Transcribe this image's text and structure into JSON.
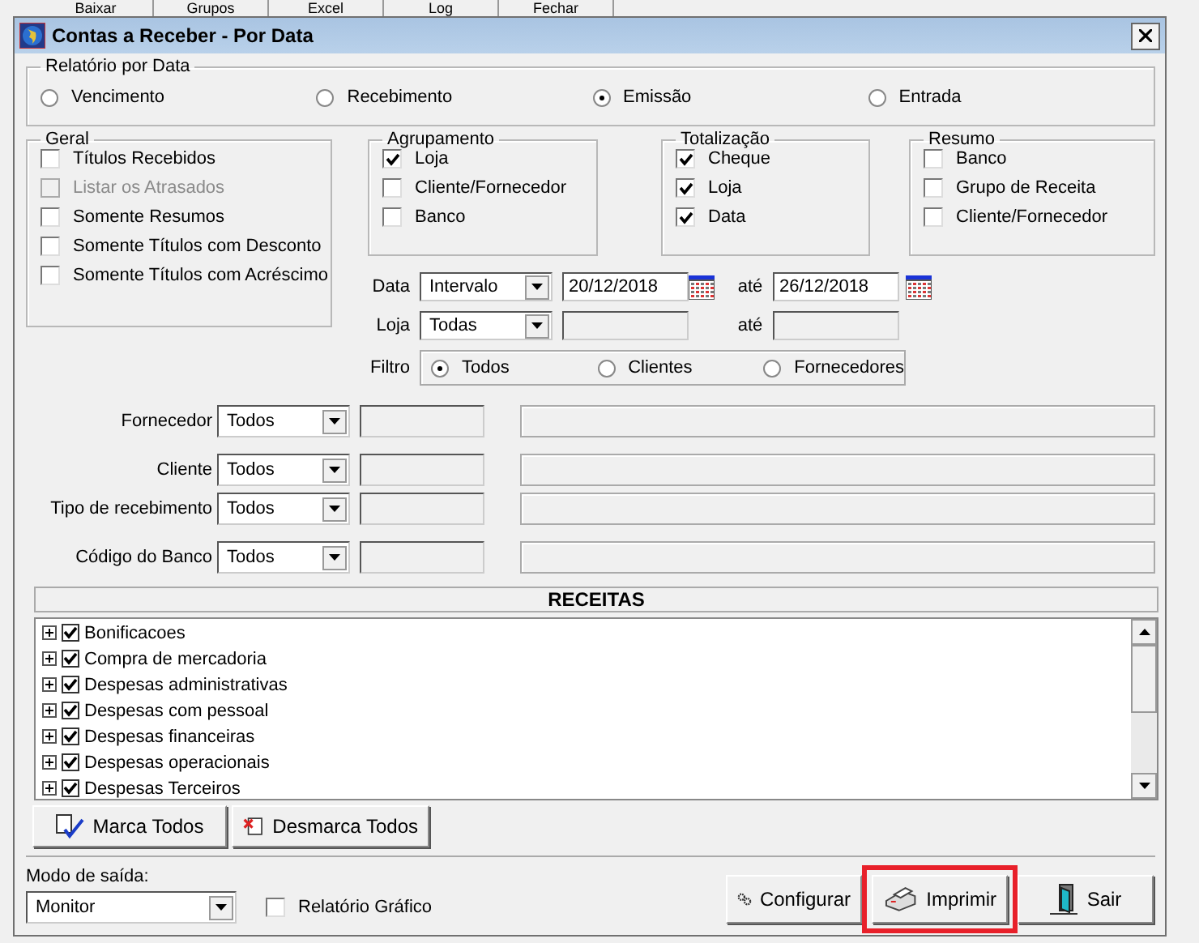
{
  "background_menu": [
    "Baixar",
    "Grupos",
    "Excel",
    "Log",
    "Fechar"
  ],
  "window": {
    "title": "Contas a Receber - Por Data"
  },
  "relatorio_por_data": {
    "title": "Relatório por Data",
    "options": [
      {
        "label": "Vencimento",
        "selected": false
      },
      {
        "label": "Recebimento",
        "selected": false
      },
      {
        "label": "Emissão",
        "selected": true
      },
      {
        "label": "Entrada",
        "selected": false
      }
    ]
  },
  "geral": {
    "title": "Geral",
    "items": [
      {
        "label": "Títulos Recebidos",
        "checked": false,
        "disabled": false
      },
      {
        "label": "Listar os Atrasados",
        "checked": false,
        "disabled": true
      },
      {
        "label": "Somente Resumos",
        "checked": false,
        "disabled": false
      },
      {
        "label": "Somente Títulos com Desconto",
        "checked": false,
        "disabled": false
      },
      {
        "label": "Somente Títulos com Acréscimo",
        "checked": false,
        "disabled": false
      }
    ]
  },
  "agrupamento": {
    "title": "Agrupamento",
    "items": [
      {
        "label": "Loja",
        "checked": true
      },
      {
        "label": "Cliente/Fornecedor",
        "checked": false
      },
      {
        "label": "Banco",
        "checked": false
      }
    ]
  },
  "totalizacao": {
    "title": "Totalização",
    "items": [
      {
        "label": "Cheque",
        "checked": true
      },
      {
        "label": "Loja",
        "checked": true
      },
      {
        "label": "Data",
        "checked": true
      }
    ]
  },
  "resumo": {
    "title": "Resumo",
    "items": [
      {
        "label": "Banco",
        "checked": false
      },
      {
        "label": "Grupo de Receita",
        "checked": false
      },
      {
        "label": "Cliente/Fornecedor",
        "checked": false
      }
    ]
  },
  "data": {
    "label": "Data",
    "select": "Intervalo",
    "from": "20/12/2018",
    "to_label": "até",
    "to": "26/12/2018"
  },
  "loja": {
    "label": "Loja",
    "select": "Todas",
    "to_label": "até"
  },
  "filtro": {
    "label": "Filtro",
    "options": [
      {
        "label": "Todos",
        "selected": true
      },
      {
        "label": "Clientes",
        "selected": false
      },
      {
        "label": "Fornecedores",
        "selected": false
      }
    ]
  },
  "lookups": [
    {
      "label": "Fornecedor",
      "value": "Todos"
    },
    {
      "label": "Cliente",
      "value": "Todos"
    },
    {
      "label": "Tipo de recebimento",
      "value": "Todos"
    },
    {
      "label": "Código do Banco",
      "value": "Todos"
    }
  ],
  "receitas": {
    "title": "RECEITAS",
    "items": [
      {
        "label": "Bonificacoes",
        "checked": true,
        "expanded": false
      },
      {
        "label": "Compra de mercadoria",
        "checked": true,
        "expanded": false
      },
      {
        "label": "Despesas administrativas",
        "checked": true,
        "expanded": false
      },
      {
        "label": "Despesas com pessoal",
        "checked": true,
        "expanded": false
      },
      {
        "label": "Despesas financeiras",
        "checked": true,
        "expanded": false
      },
      {
        "label": "Despesas operacionais",
        "checked": true,
        "expanded": false
      },
      {
        "label": "Despesas Terceiros",
        "checked": true,
        "expanded": false
      }
    ]
  },
  "marca_todos": "Marca Todos",
  "desmarca_todos": "Desmarca Todos",
  "modo_saida": {
    "label": "Modo de saída:",
    "value": "Monitor"
  },
  "relatorio_grafico": {
    "label": "Relatório Gráfico",
    "checked": false
  },
  "actions": [
    {
      "label": "Configurar",
      "kind": "config",
      "highlighted": false
    },
    {
      "label": "Imprimir",
      "kind": "print",
      "highlighted": true
    },
    {
      "label": "Sair",
      "kind": "exit",
      "highlighted": false
    }
  ]
}
